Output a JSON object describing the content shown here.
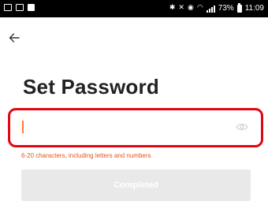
{
  "status_bar": {
    "battery_percent": "73%",
    "time": "11:09",
    "icons": [
      "image-icon",
      "image-icon",
      "notification-icon",
      "bluetooth-icon",
      "mute-icon",
      "alarm-icon",
      "wifi-icon",
      "signal-icon",
      "battery-icon"
    ]
  },
  "nav": {
    "back_icon": "arrow-left-icon"
  },
  "page": {
    "title": "Set Password"
  },
  "password_field": {
    "value": "",
    "placeholder": "",
    "visibility_icon": "eye-icon"
  },
  "hint": {
    "text": "6-20 characters, including letters and numbers"
  },
  "submit": {
    "label": "Completed",
    "enabled": false
  },
  "colors": {
    "accent": "#ff7a2f",
    "hint": "#e8531c",
    "highlight": "#e30613",
    "disabled_button": "#e9e9e9"
  }
}
